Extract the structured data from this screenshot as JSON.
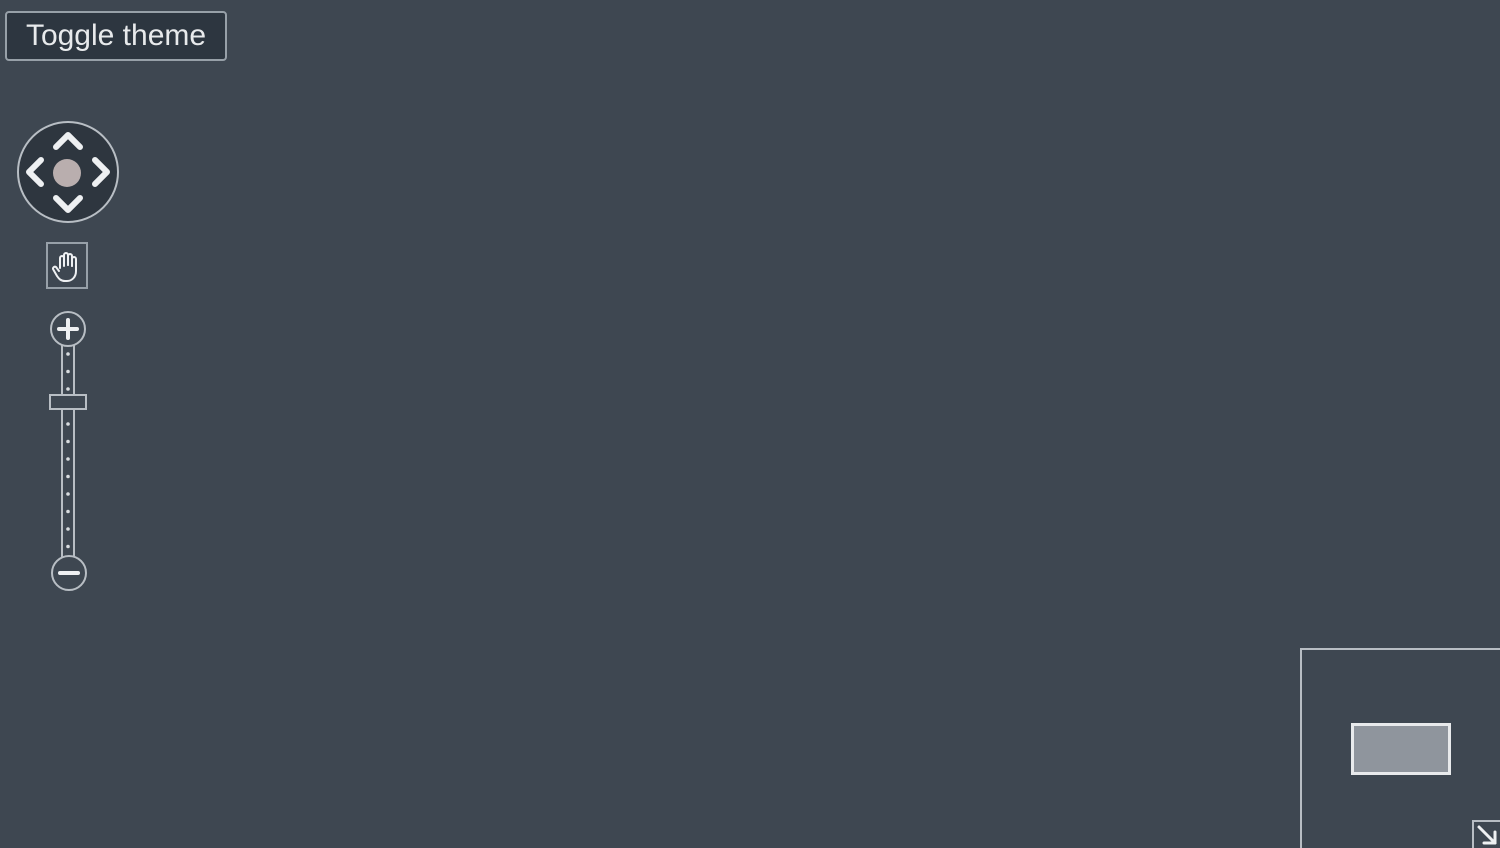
{
  "toolbar": {
    "toggle_theme_label": "Toggle theme"
  },
  "navigation": {
    "pan_icons": [
      "chevron-up-icon",
      "chevron-down-icon",
      "chevron-left-icon",
      "chevron-right-icon",
      "pan-center-icon"
    ],
    "hand_tool_icon": "hand-icon",
    "zoom_icons": [
      "plus-icon",
      "minus-icon"
    ],
    "zoom_level": 0.72
  },
  "overview": {
    "toggle_icon": "arrow-down-right-icon"
  },
  "colors": {
    "background": "#3e4751",
    "control_stroke": "#e8eaec",
    "control_border": "#97a0a8",
    "pan_center": "#b9aeae",
    "overview_viewport": "#8f959d"
  }
}
